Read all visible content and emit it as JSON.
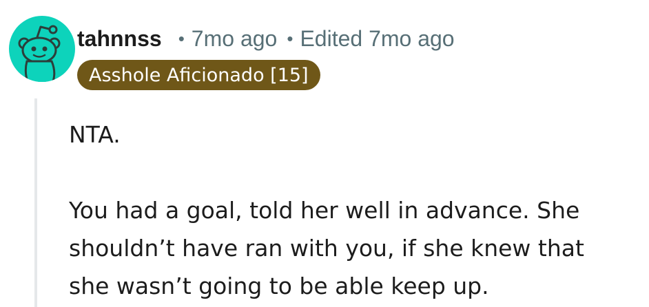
{
  "comment": {
    "author": "tahnnss",
    "separator": "•",
    "timestamp": "7mo ago",
    "edited": "Edited 7mo ago",
    "flair": "Asshole Aficionado [15]",
    "paragraphs": [
      "NTA.",
      "You had a goal, told her well in advance. She shouldn’t have ran with you, if she knew that she wasn’t going to be able keep up."
    ],
    "body_lines": [
      "You had a goal, told her well in advance. She",
      "shouldn’t have ran with you, if she knew that",
      "she wasn’t going to be able keep up."
    ]
  },
  "avatar": {
    "icon": "snoo-avatar-icon",
    "background_color": "#0dd3bb"
  },
  "colors": {
    "text": "#1c1c1c",
    "meta": "#576f76",
    "flair_bg": "#6f5718",
    "flair_text": "#ffffff",
    "thread_line": "#e5e8ea"
  }
}
